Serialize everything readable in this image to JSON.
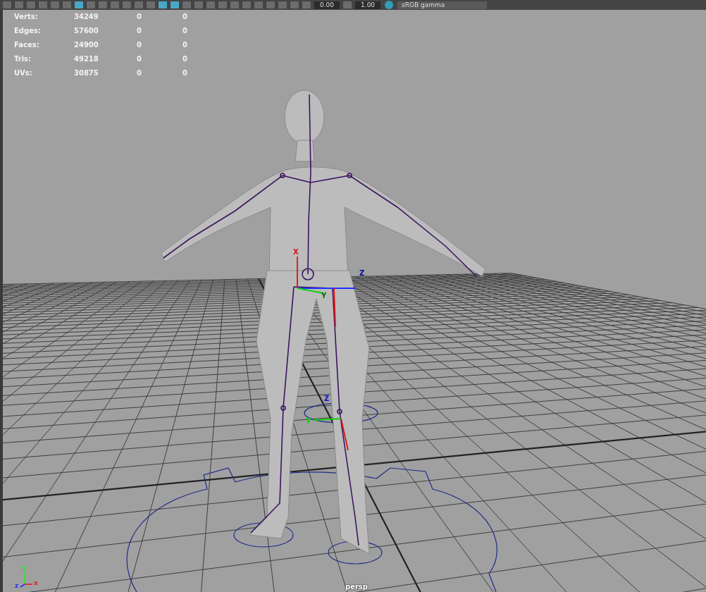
{
  "toolbar": {
    "buttons": [
      {
        "on": false
      },
      {
        "on": false
      },
      {
        "on": false
      },
      {
        "on": false
      },
      {
        "on": false
      },
      {
        "on": false
      },
      {
        "on": true
      },
      {
        "on": false
      },
      {
        "on": false
      },
      {
        "on": false
      },
      {
        "on": false
      },
      {
        "on": false
      },
      {
        "on": false
      },
      {
        "on": true
      },
      {
        "on": true
      },
      {
        "on": false
      },
      {
        "on": false
      },
      {
        "on": false
      },
      {
        "on": false
      },
      {
        "on": false
      },
      {
        "on": false
      },
      {
        "on": false
      },
      {
        "on": false
      },
      {
        "on": false
      },
      {
        "on": false
      },
      {
        "on": false
      }
    ],
    "exposure": "0.00",
    "gamma": "1.00",
    "view_transform": "sRGB gamma"
  },
  "stats": [
    {
      "label": "Verts:",
      "value": "34249",
      "column_2": "0",
      "column_3": "0"
    },
    {
      "label": "Edges:",
      "value": "57600",
      "column_2": "0",
      "column_3": "0"
    },
    {
      "label": "Faces:",
      "value": "24900",
      "column_2": "0",
      "column_3": "0"
    },
    {
      "label": "Tris:",
      "value": "49218",
      "column_2": "0",
      "column_3": "0"
    },
    {
      "label": "UVs:",
      "value": "30875",
      "column_2": "0",
      "column_3": "0"
    }
  ],
  "manipulator_labels": {
    "x": "X",
    "y": "Y",
    "z": "Z"
  },
  "foot_manipulator_labels": {
    "y": "Y",
    "z": "Z"
  },
  "axis_labels": {
    "x": "x",
    "y": "y",
    "z": "z"
  },
  "camera_name": "persp"
}
